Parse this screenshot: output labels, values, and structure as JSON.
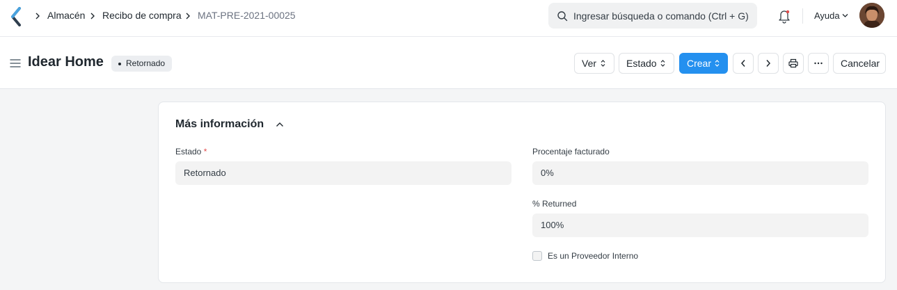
{
  "navbar": {
    "breadcrumbs": [
      "Almacén",
      "Recibo de compra",
      "MAT-PRE-2021-00025"
    ],
    "search_placeholder": "Ingresar búsqueda o comando (Ctrl + G)",
    "help_label": "Ayuda",
    "icons": [
      "app-logo-icon",
      "search-icon",
      "bell-icon",
      "chevron-down-icon",
      "avatar"
    ]
  },
  "page": {
    "title": "Idear Home",
    "status": "Retornado",
    "buttons": {
      "view": "Ver",
      "status": "Estado",
      "create": "Crear",
      "cancel": "Cancelar"
    },
    "icon_buttons": [
      "chevron-left-icon",
      "chevron-right-icon",
      "printer-icon",
      "more-icon"
    ]
  },
  "section": {
    "title": "Más información",
    "fields": {
      "estado": {
        "label": "Estado",
        "required_mark": "*",
        "value": "Retornado"
      },
      "billed": {
        "label": "Procentaje facturado",
        "value": "0%"
      },
      "returned": {
        "label": "% Returned",
        "value": "100%"
      },
      "internal_supplier": {
        "label": "Es un Proveedor Interno",
        "checked": false
      }
    }
  },
  "colors": {
    "primary": "#2490ef",
    "required": "#e24c4c",
    "background": "#f4f5f6"
  }
}
